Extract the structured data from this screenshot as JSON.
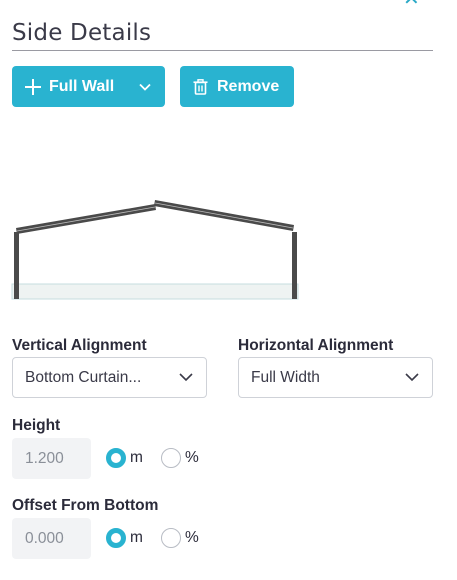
{
  "panel": {
    "title": "Side Details",
    "close_icon": "close-icon"
  },
  "toolbar": {
    "full_wall_label": "Full Wall",
    "remove_label": "Remove",
    "accent_color": "#29b3d0"
  },
  "alignment": {
    "vertical_label": "Vertical Alignment",
    "vertical_value": "Bottom Curtain...",
    "horizontal_label": "Horizontal Alignment",
    "horizontal_value": "Full Width"
  },
  "height": {
    "label": "Height",
    "value": "1.200",
    "unit_m": "m",
    "unit_pct": "%",
    "selected_unit": "m"
  },
  "offset": {
    "label": "Offset From Bottom",
    "value": "0.000",
    "unit_m": "m",
    "unit_pct": "%",
    "selected_unit": "m"
  }
}
